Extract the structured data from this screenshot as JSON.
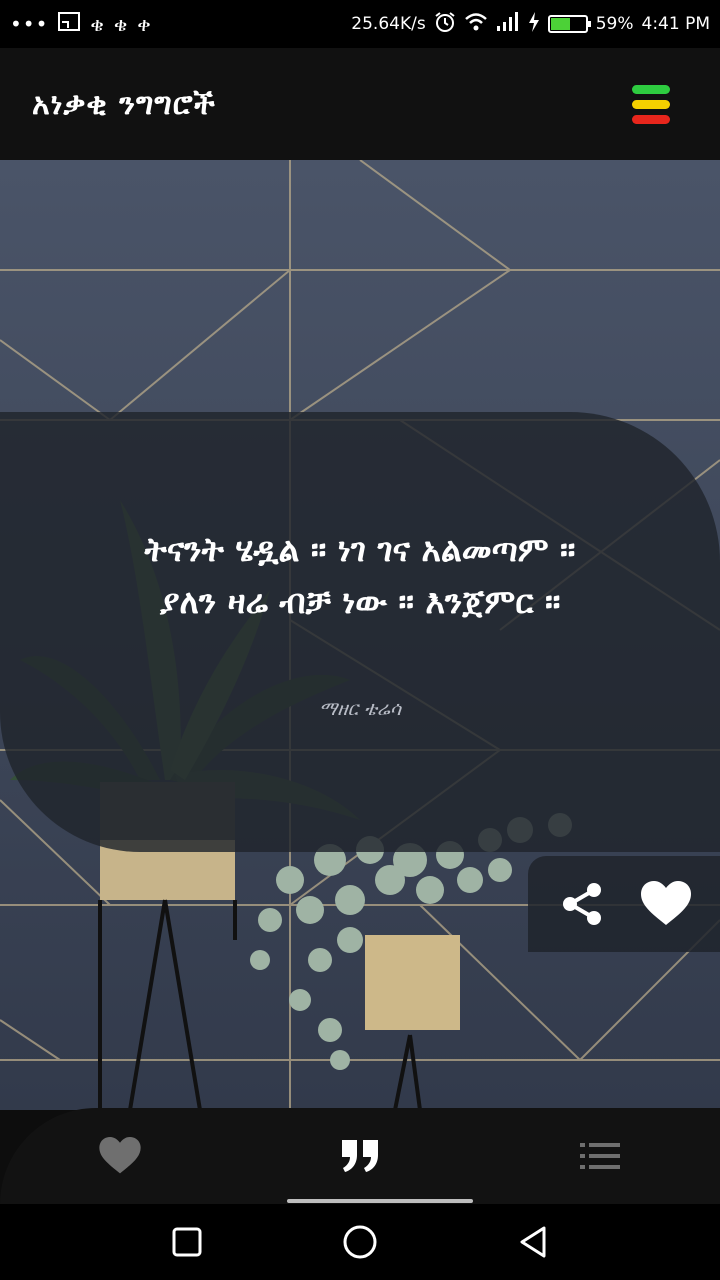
{
  "status_bar": {
    "left_icons": [
      "more-dots-icon",
      "screen-cast-icon",
      "app-notification-icon",
      "app-notification-icon",
      "app-notification-icon"
    ],
    "net_speed": "25.64K/s",
    "battery_percent_text": "59%",
    "battery_level": 0.59,
    "time": "4:41 PM"
  },
  "app_bar": {
    "title": "አነቃቂ ንግግሮች",
    "menu_flag_colors": [
      "#2ecc40",
      "#f5d000",
      "#e8261c"
    ]
  },
  "quote": {
    "line1": "ትናንት ሄዷል ። ነገ ገና አልመጣም ።",
    "line2": "ያለን ዛሬ ብቻ ነው ። እንጀምር ።",
    "author": "ማዘር ቴሬሳ"
  },
  "actions": {
    "share_icon": "share-icon",
    "favorite_icon": "heart-icon"
  },
  "bottom_nav": {
    "items": [
      {
        "icon": "heart-icon",
        "active": false
      },
      {
        "icon": "quote-icon",
        "active": true
      },
      {
        "icon": "list-icon",
        "active": false
      }
    ]
  },
  "system_nav": [
    "recent-apps-icon",
    "home-icon",
    "back-icon"
  ],
  "colors": {
    "wall": "#3b4558",
    "card": "#20242c",
    "accent_active": "#ffffff",
    "inactive_icon": "#6f6f6f"
  }
}
